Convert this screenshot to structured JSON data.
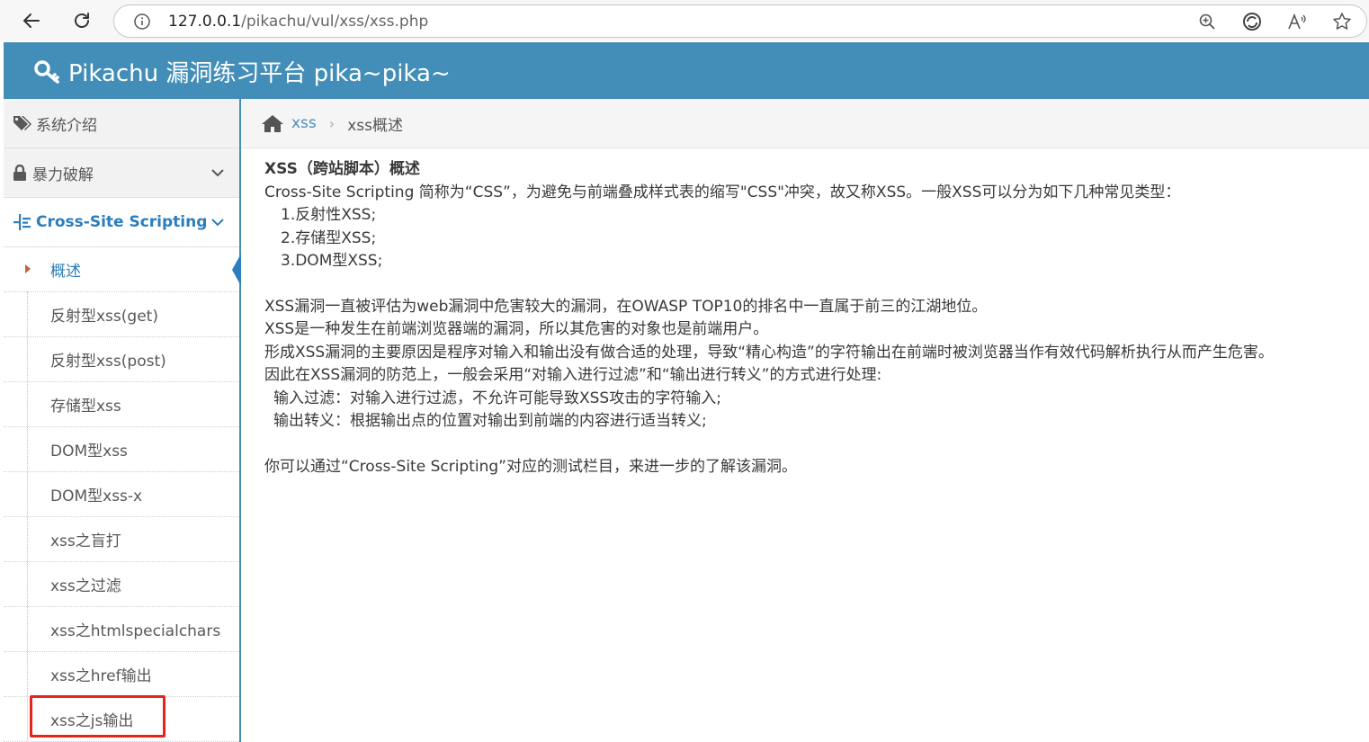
{
  "browser": {
    "url_host": "127.0.0.1",
    "url_path": "/pikachu/vul/xss/xss.php"
  },
  "header": {
    "brand": "Pikachu 漏洞练习平台 pika~pika~"
  },
  "sidebar": {
    "sections": [
      {
        "label": "系统介绍",
        "icon": "tags-icon"
      },
      {
        "label": "暴力破解",
        "icon": "lock-icon"
      },
      {
        "label": "Cross-Site Scripting",
        "icon": "list-icon"
      }
    ],
    "items": [
      {
        "label": "概述"
      },
      {
        "label": "反射型xss(get)"
      },
      {
        "label": "反射型xss(post)"
      },
      {
        "label": "存储型xss"
      },
      {
        "label": "DOM型xss"
      },
      {
        "label": "DOM型xss-x"
      },
      {
        "label": "xss之盲打"
      },
      {
        "label": "xss之过滤"
      },
      {
        "label": "xss之htmlspecialchars"
      },
      {
        "label": "xss之href输出"
      },
      {
        "label": "xss之js输出"
      }
    ]
  },
  "breadcrumb": {
    "link": "xss",
    "current": "xss概述"
  },
  "content": {
    "title": "XSS（跨站脚本）概述",
    "lines": [
      "Cross-Site Scripting 简称为“CSS”，为避免与前端叠成样式表的缩写\"CSS\"冲突，故又称XSS。一般XSS可以分为如下几种常见类型：",
      "1.反射性XSS;",
      "2.存储型XSS;",
      "3.DOM型XSS;",
      "XSS漏洞一直被评估为web漏洞中危害较大的漏洞，在OWASP TOP10的排名中一直属于前三的江湖地位。",
      "XSS是一种发生在前端浏览器端的漏洞，所以其危害的对象也是前端用户。",
      "形成XSS漏洞的主要原因是程序对输入和输出没有做合适的处理，导致“精心构造”的字符输出在前端时被浏览器当作有效代码解析执行从而产生危害。",
      "因此在XSS漏洞的防范上，一般会采用“对输入进行过滤”和“输出进行转义”的方式进行处理:",
      "输入过滤：对输入进行过滤，不允许可能导致XSS攻击的字符输入;",
      "输出转义：根据输出点的位置对输出到前端的内容进行适当转义;",
      "你可以通过“Cross-Site Scripting”对应的测试栏目，来进一步的了解该漏洞。"
    ]
  },
  "colors": {
    "header_bg": "#438eb9",
    "link": "#2b7dbc",
    "highlight_box": "#e52420"
  }
}
